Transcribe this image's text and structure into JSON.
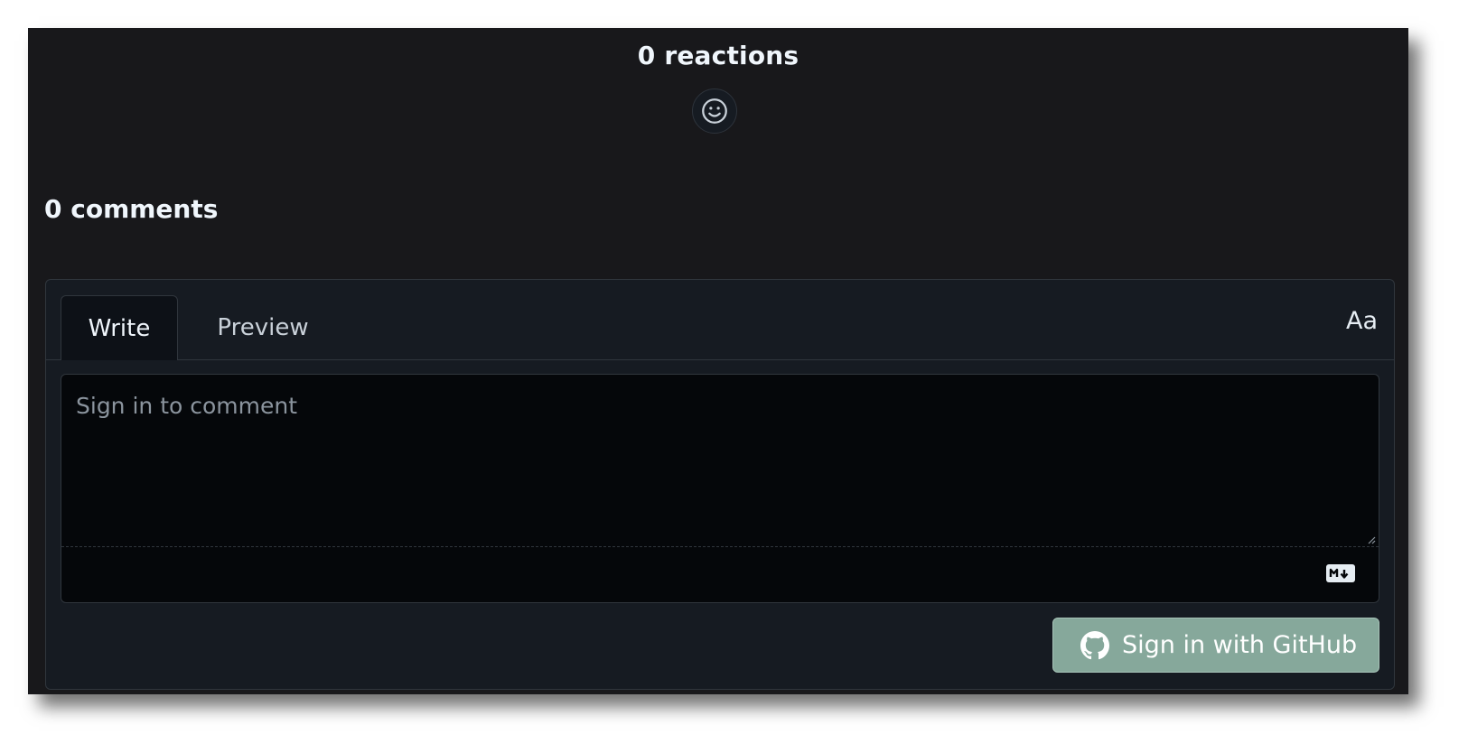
{
  "reactions": {
    "title": "0 reactions",
    "add_icon": "smiley-icon"
  },
  "comments": {
    "title": "0 comments"
  },
  "editor": {
    "tabs": [
      {
        "label": "Write",
        "active": true
      },
      {
        "label": "Preview",
        "active": false
      }
    ],
    "format_toggle": "Aa",
    "textarea_placeholder": "Sign in to comment",
    "textarea_value": "",
    "markdown_icon": "markdown-icon"
  },
  "signin": {
    "label": "Sign in with GitHub",
    "icon": "github-icon"
  },
  "colors": {
    "background": "#18181b",
    "editor_bg": "#161b22",
    "textarea_bg": "#05070a",
    "border": "#30363d",
    "button_bg": "#86a89b"
  }
}
